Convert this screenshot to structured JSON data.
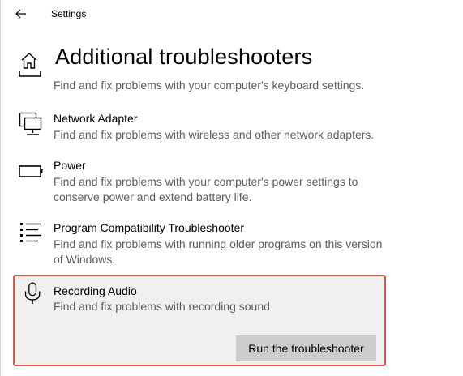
{
  "window": {
    "app_title": "Settings"
  },
  "header": {
    "page_title": "Additional troubleshooters"
  },
  "partial_item": {
    "description": "Find and fix problems with your computer's keyboard settings."
  },
  "items": [
    {
      "icon": "network-adapter-icon",
      "title": "Network Adapter",
      "description": "Find and fix problems with wireless and other network adapters."
    },
    {
      "icon": "battery-icon",
      "title": "Power",
      "description": "Find and fix problems with your computer's power settings to conserve power and extend battery life."
    },
    {
      "icon": "list-icon",
      "title": "Program Compatibility Troubleshooter",
      "description": "Find and fix problems with running older programs on this version of Windows."
    },
    {
      "icon": "microphone-icon",
      "title": "Recording Audio",
      "description": "Find and fix problems with recording sound",
      "selected": true
    }
  ],
  "actions": {
    "run_label": "Run the troubleshooter"
  },
  "colors": {
    "selection_border": "#e0544d",
    "selection_background": "#f0f0f0",
    "button_background": "#cccccc",
    "description_text": "#5d5d5d"
  }
}
